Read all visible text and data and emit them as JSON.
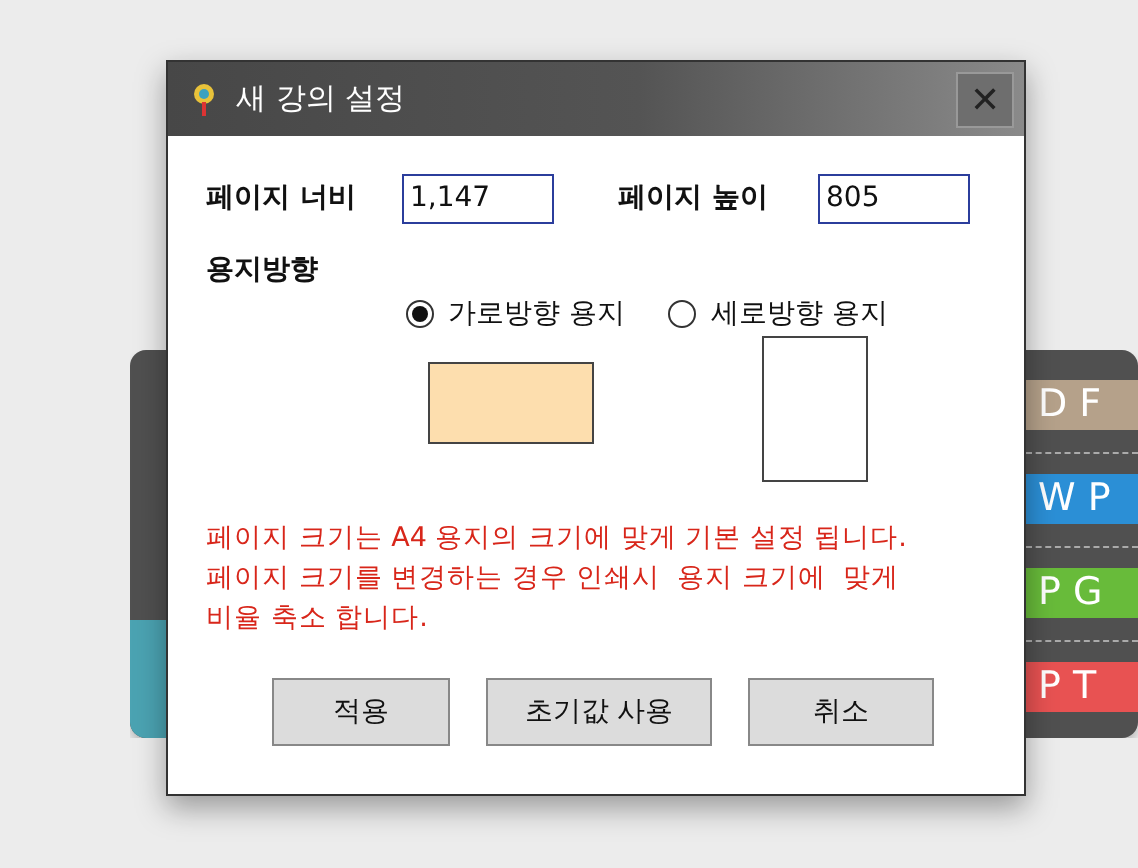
{
  "background_panel": {
    "tiles": [
      {
        "label": "D F",
        "color": "#b5a18a"
      },
      {
        "label": "W P",
        "color": "#2b8fd6"
      },
      {
        "label": "P G",
        "color": "#68bb3a"
      },
      {
        "label": "P T",
        "color": "#e85252"
      }
    ]
  },
  "dialog": {
    "title": "새 강의 설정",
    "close": "✕",
    "fields": [
      {
        "label": "페이지 너비",
        "value": "1,147"
      },
      {
        "label": "페이지 높이",
        "value": "805"
      }
    ],
    "orientation_label": "용지방향",
    "orientations": [
      {
        "kind": "landscape",
        "label": "가로방향 용지",
        "selected": true
      },
      {
        "kind": "portrait",
        "label": "세로방향 용지",
        "selected": false
      }
    ],
    "notice": "페이지 크기는 A4 용지의 크기에 맞게 기본 설정 됩니다.\n페이지 크기를 변경하는 경우 인쇄시  용지 크기에  맞게\n비율 축소 합니다.",
    "buttons": [
      "적용",
      "초기값 사용",
      "취소"
    ]
  }
}
